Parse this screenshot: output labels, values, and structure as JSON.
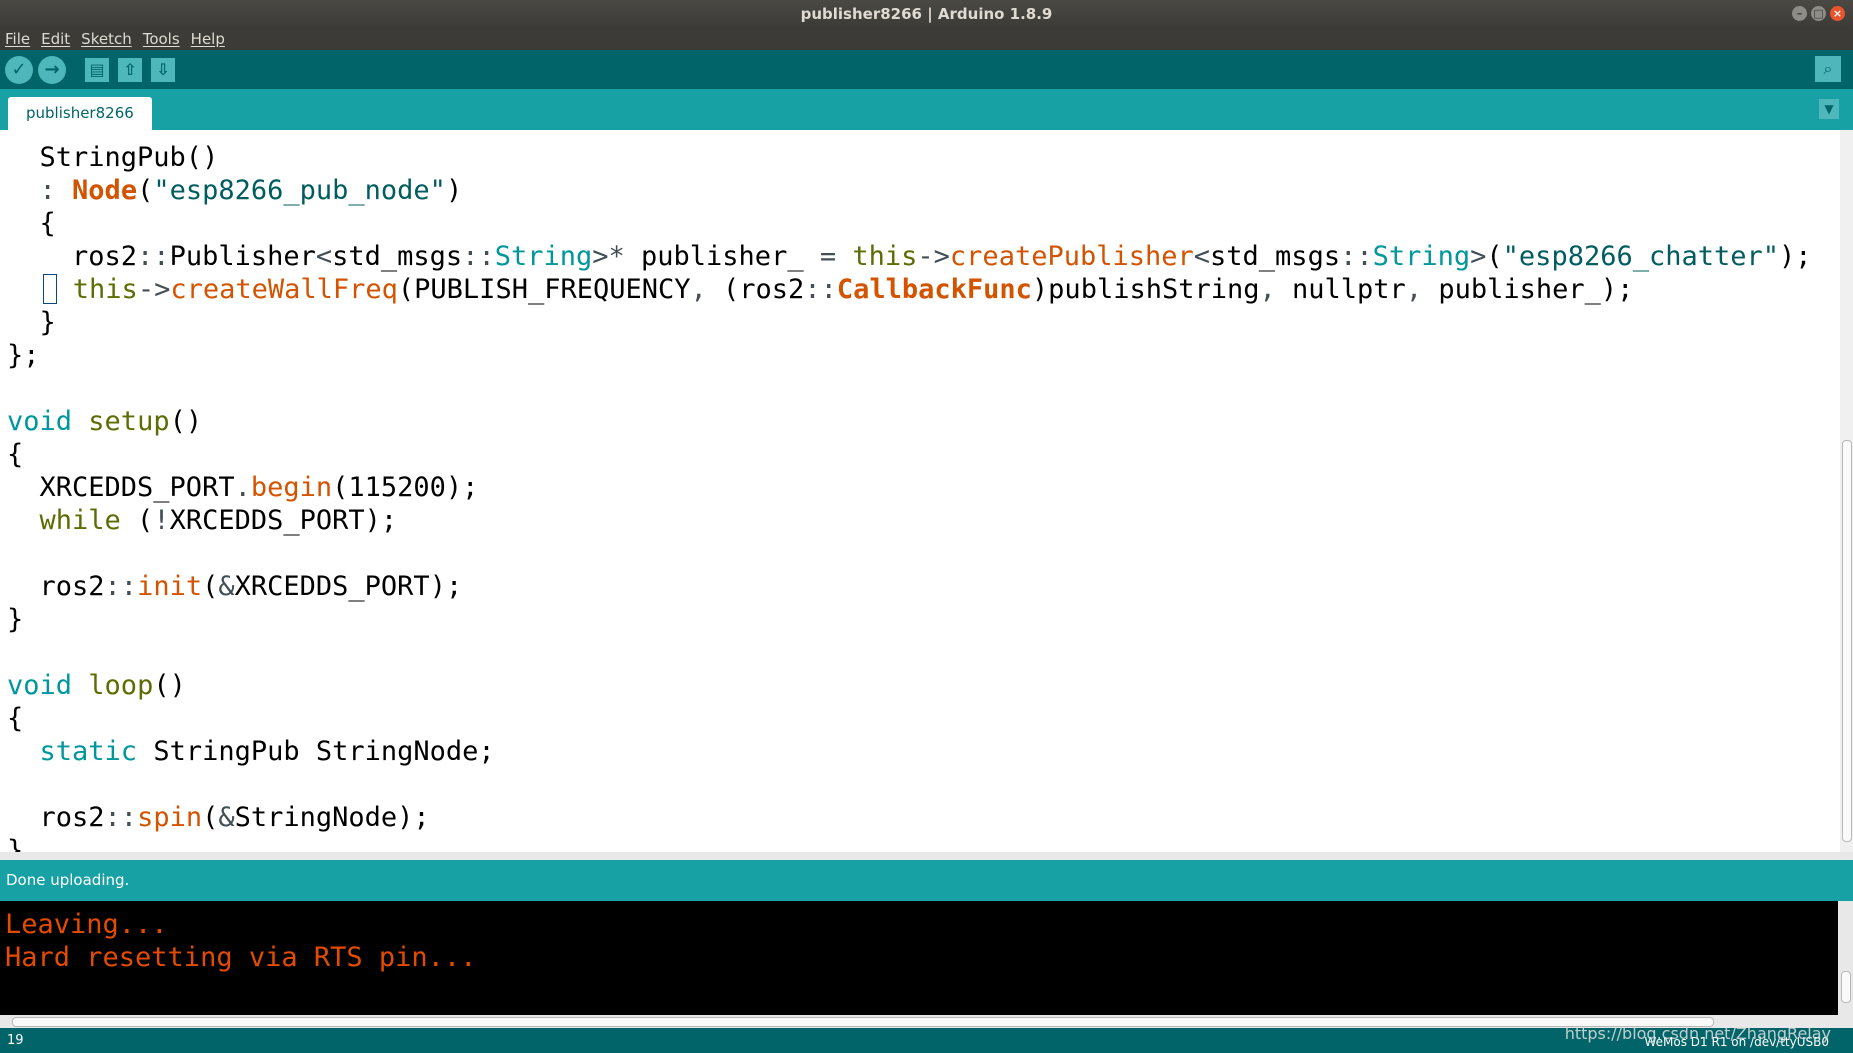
{
  "window": {
    "title": "publisher8266 | Arduino 1.8.9"
  },
  "menu": [
    "File",
    "Edit",
    "Sketch",
    "Tools",
    "Help"
  ],
  "tabs": [
    {
      "label": "publisher8266"
    }
  ],
  "status": {
    "message": "Done uploading."
  },
  "console": {
    "lines": [
      "Leaving...",
      "Hard resetting via RTS pin..."
    ]
  },
  "footer": {
    "line_number": "19",
    "board": "WeMos D1 R1 on /dev/ttyUSB0",
    "watermark": "https://blog.csdn.net/ZhangRelay"
  },
  "colors": {
    "toolbar": "#006468",
    "tabbar": "#17a1a5",
    "keyword": "#00979c",
    "function": "#d35400",
    "console_text": "#e34c00"
  }
}
